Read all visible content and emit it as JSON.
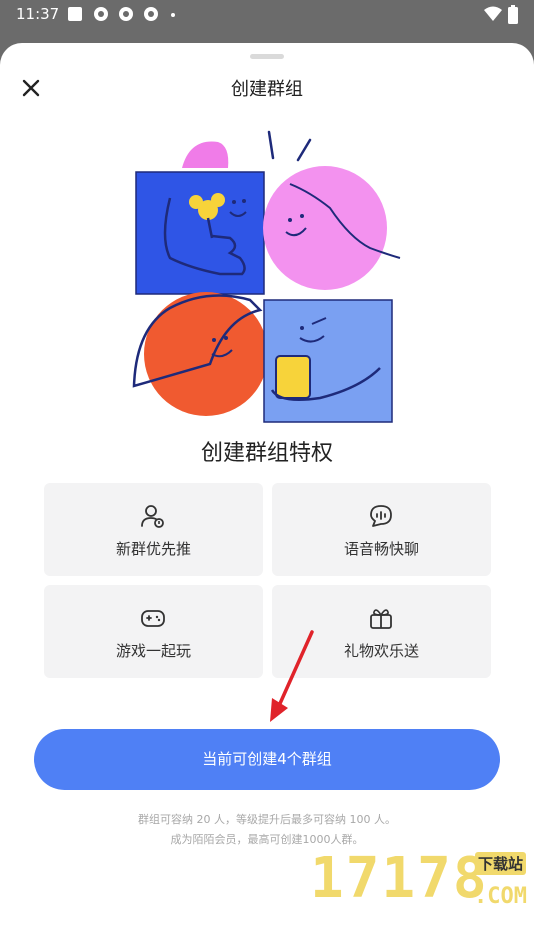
{
  "status_bar": {
    "time": "11:37"
  },
  "sheet": {
    "title": "创建群组",
    "section_title": "创建群组特权"
  },
  "features": [
    {
      "label": "新群优先推",
      "icon": "user-boost-icon"
    },
    {
      "label": "语音畅快聊",
      "icon": "voice-chat-icon"
    },
    {
      "label": "游戏一起玩",
      "icon": "gamepad-icon"
    },
    {
      "label": "礼物欢乐送",
      "icon": "gift-icon"
    }
  ],
  "primary_button": {
    "label": "当前可创建4个群组"
  },
  "notes": {
    "line1": "群组可容纳 20 人，等级提升后最多可容纳 100 人。",
    "line2": "成为陌陌会员，最高可创建1000人群。"
  },
  "watermark": {
    "number": "17178",
    "sub": "下载站",
    "domain": ".COM"
  },
  "colors": {
    "primary": "#4f80f5",
    "card_bg": "#f3f3f4",
    "arrow": "#e0232a"
  }
}
